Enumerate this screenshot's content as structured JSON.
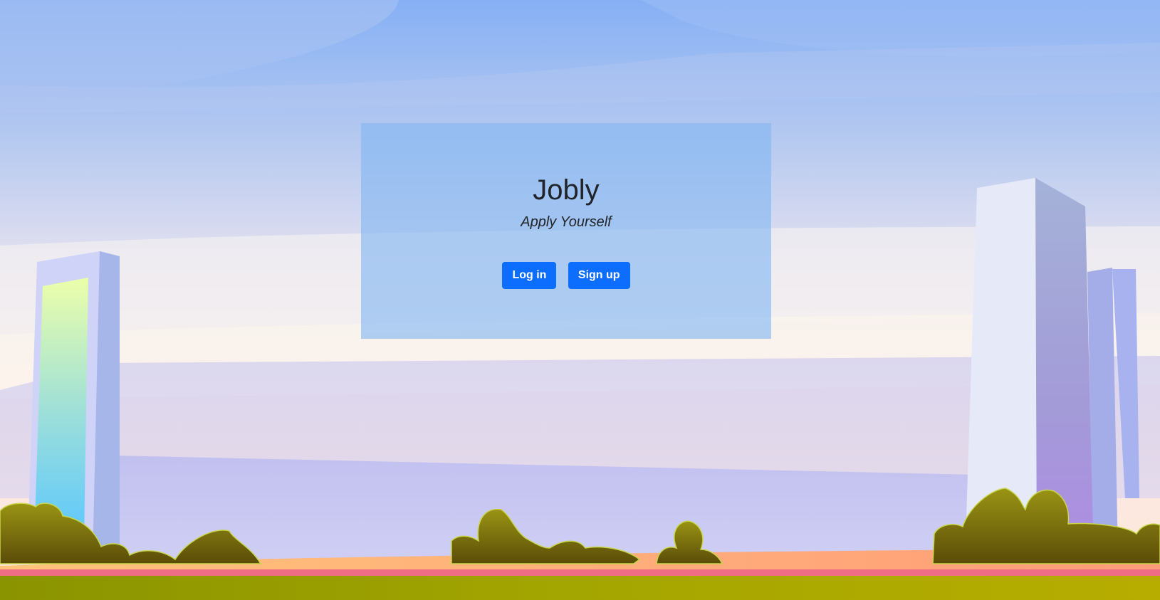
{
  "app": {
    "title": "Jobly",
    "tagline": "Apply Yourself"
  },
  "actions": {
    "login_label": "Log in",
    "signup_label": "Sign up"
  },
  "colors": {
    "primary_button": "#0d6efd",
    "card_background": "#82b6f2",
    "text": "#212529"
  }
}
